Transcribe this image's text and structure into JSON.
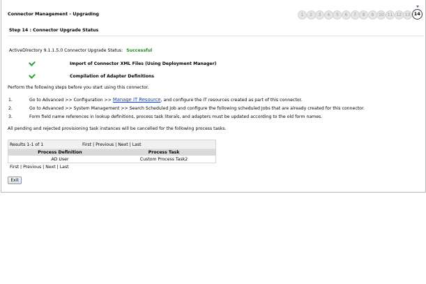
{
  "header": {
    "title": "Connector Management - Upgrading"
  },
  "steps": [
    "1",
    "2",
    "3",
    "4",
    "5",
    "6",
    "7",
    "8",
    "9",
    "10",
    "11",
    "12",
    "13",
    "14"
  ],
  "current_step": "14",
  "step_title": "Step 14 : Connector Upgrade Status",
  "status": {
    "label": "ActiveDirectory 9.1.1.5.0 Connector Upgrade Status:",
    "value": "Successful"
  },
  "checks": [
    "Import of Connector XML Files (Using Deployment Manager)",
    "Compilation of Adapter Definitions"
  ],
  "perform_text": "Perform the following steps before you start using this connector.",
  "instructions": [
    {
      "num": "1.",
      "before": "Go to Advanced >> Configuration >> ",
      "link": "Manage IT Resource",
      "after": ", and configure the IT resources created as part of this connector."
    },
    {
      "num": "2.",
      "text": "Go to Advanced >> System Management >> Search Scheduled Job and configure the following scheduled Jobs that are already created for this connector."
    },
    {
      "num": "3.",
      "text": "Form field name references in lookup definitions, process task literals, and adapters must be updated according to the old form names."
    }
  ],
  "cancel_text": "All pending and rejected provisioning task instances will be cancelled for the following process tasks.",
  "results": {
    "count": "Results 1-1 of 1",
    "pager": {
      "first": "First",
      "previous": "Previous",
      "next": "Next",
      "last": "Last",
      "sep": " | "
    },
    "columns": [
      "Process Definition",
      "Process Task"
    ],
    "rows": [
      [
        "AD User",
        "Custom Process Task2"
      ]
    ]
  },
  "exit_label": "Exit"
}
